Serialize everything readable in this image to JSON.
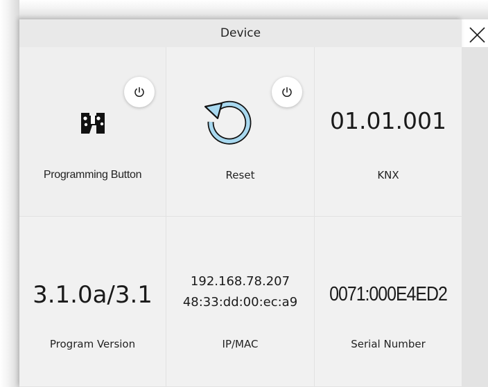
{
  "dialog": {
    "title": "Device",
    "close_icon": "close-icon"
  },
  "tiles": {
    "programming": {
      "label": "Programming Button",
      "icon": "programming-button-icon",
      "action_icon": "power-icon"
    },
    "reset": {
      "label": "Reset",
      "icon": "reset-icon",
      "action_icon": "power-icon",
      "icon_color": "#a8d8ef"
    },
    "knx": {
      "value": "01.01.001",
      "label": "KNX"
    },
    "program_version": {
      "value": "3.1.0a/3.1",
      "label": "Program Version"
    },
    "ip_mac": {
      "ip": "192.168.78.207",
      "mac": "48:33:dd:00:ec:a9",
      "label": "IP/MAC"
    },
    "serial": {
      "value": "0071:000E4ED2",
      "label": "Serial Number"
    }
  }
}
